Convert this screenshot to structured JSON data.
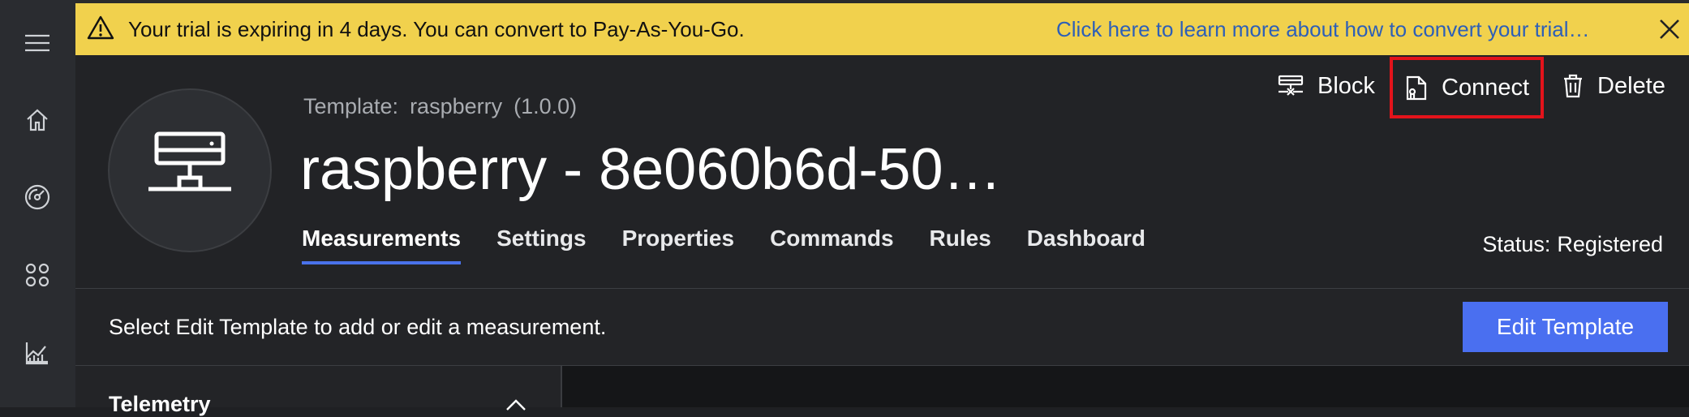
{
  "banner": {
    "message": "Your trial is expiring in 4 days. You can convert to Pay-As-You-Go.",
    "link": "Click here to learn more about how to convert your trial…"
  },
  "device": {
    "template_label": "Template:",
    "template_name": "raspberry",
    "template_version": "(1.0.0)",
    "title": "raspberry - 8e060b6d-50…"
  },
  "actions": {
    "block": "Block",
    "connect": "Connect",
    "delete": "Delete"
  },
  "tabs": [
    {
      "label": "Measurements",
      "active": true
    },
    {
      "label": "Settings"
    },
    {
      "label": "Properties"
    },
    {
      "label": "Commands"
    },
    {
      "label": "Rules"
    },
    {
      "label": "Dashboard"
    }
  ],
  "status": {
    "label": "Status:",
    "value": "Registered"
  },
  "info": {
    "text": "Select Edit Template to add or edit a measurement.",
    "button": "Edit Template"
  },
  "telemetry": {
    "heading": "Telemetry"
  },
  "colors": {
    "banner": "#f1d14d",
    "accent": "#4a6ff0",
    "highlight": "#e3131b",
    "link": "#2d5fb8"
  }
}
